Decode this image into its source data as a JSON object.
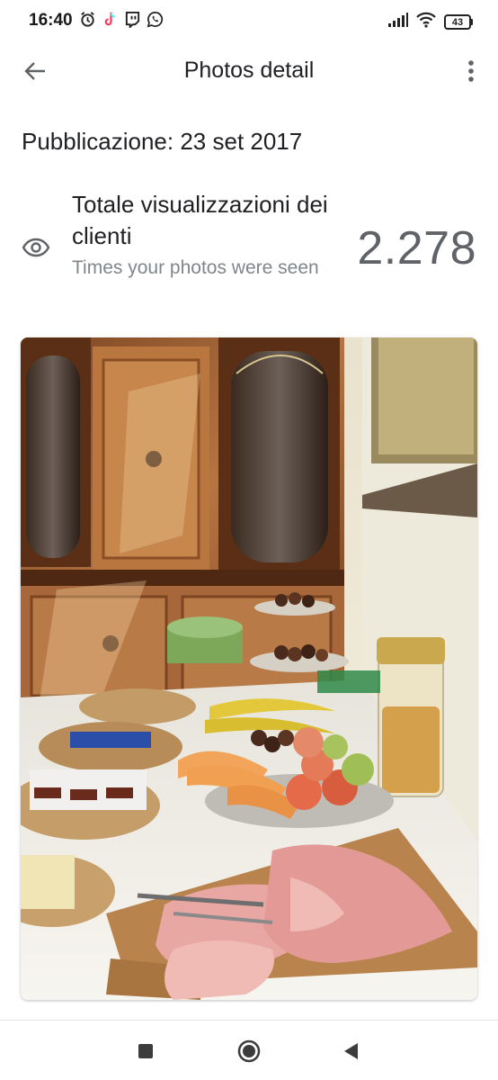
{
  "status_bar": {
    "time": "16:40",
    "battery_level": "43",
    "left_icons": [
      "alarm-icon",
      "tiktok-icon",
      "twitch-icon",
      "whatsapp-icon"
    ],
    "right_icons": [
      "signal-icon",
      "wifi-icon",
      "battery-icon"
    ]
  },
  "app_bar": {
    "title": "Photos detail",
    "back_icon": "arrow-back-icon",
    "menu_icon": "more-vert-icon"
  },
  "publication": {
    "text": "Pubblicazione: 23 set 2017"
  },
  "stats": {
    "title": "Totale visualizzazioni dei clienti",
    "subtitle": "Times your photos were seen",
    "value": "2.278",
    "icon": "eye-icon"
  },
  "photo": {
    "icon": "breakfast-buffet-photo"
  },
  "nav_bar": {
    "buttons": [
      "recent-apps-icon",
      "home-icon",
      "back-triangle-icon"
    ]
  },
  "colors": {
    "text_primary": "#202124",
    "text_secondary": "#80868b",
    "value_text": "#5f6368",
    "icon_gray": "#5f6368"
  }
}
